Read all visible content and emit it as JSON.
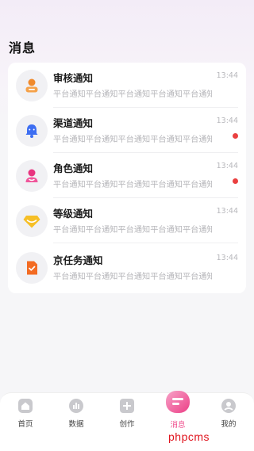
{
  "page": {
    "title": "消息"
  },
  "notifications": [
    {
      "title": "审核通知",
      "time": "13:44",
      "desc": "平台通知平台通知平台通知平台通知平台通知",
      "unread": false,
      "icon": "person-orange-icon"
    },
    {
      "title": "渠道通知",
      "time": "13:44",
      "desc": "平台通知平台通知平台通知平台通知平台通知",
      "unread": true,
      "icon": "bell-blue-icon"
    },
    {
      "title": "角色通知",
      "time": "13:44",
      "desc": "平台通知平台通知平台通知平台通知平台通知",
      "unread": true,
      "icon": "person-pink-icon"
    },
    {
      "title": "等级通知",
      "time": "13:44",
      "desc": "平台通知平台通知平台通知平台通知平台通知",
      "unread": false,
      "icon": "diamond-yellow-icon"
    },
    {
      "title": "京任务通知",
      "time": "13:44",
      "desc": "平台通知平台通知平台通知平台通知平台通知",
      "unread": false,
      "icon": "task-orange-icon"
    }
  ],
  "tabbar": {
    "items": [
      {
        "label": "首页",
        "icon": "home-icon",
        "active": false
      },
      {
        "label": "数据",
        "icon": "chart-icon",
        "active": false
      },
      {
        "label": "创作",
        "icon": "plus-square-icon",
        "active": false
      },
      {
        "label": "消息",
        "icon": "message-icon",
        "active": true
      },
      {
        "label": "我的",
        "icon": "user-icon",
        "active": false
      }
    ]
  },
  "watermark": "phpcms",
  "colors": {
    "accent": "#ef4a8a",
    "unread_dot": "#ea4040",
    "muted_text": "#b6b6ba"
  }
}
